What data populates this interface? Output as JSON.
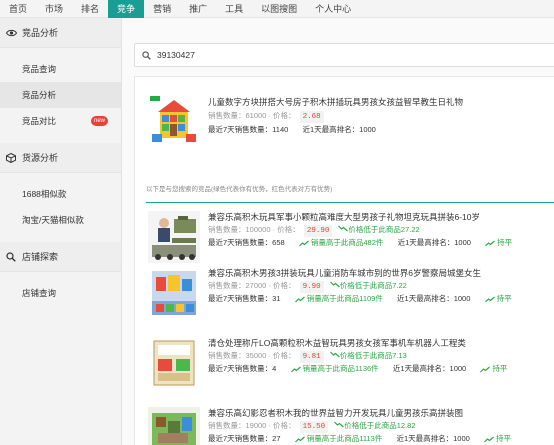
{
  "nav": {
    "items": [
      "首页",
      "市场",
      "排名",
      "竞争",
      "营销",
      "推广",
      "工具",
      "以图搜图",
      "个人中心"
    ],
    "active_index": 3
  },
  "sidebar": {
    "sections": [
      {
        "title": "竞品分析",
        "icon": "eye-icon",
        "links": [
          {
            "label": "竞品查询"
          },
          {
            "label": "竞品分析",
            "active": true
          },
          {
            "label": "竞品对比",
            "badge": "new"
          }
        ]
      },
      {
        "title": "货源分析",
        "icon": "cube-icon",
        "links": [
          {
            "label": "1688相似款"
          },
          {
            "label": "淘宝/天猫相似款"
          }
        ]
      },
      {
        "title": "店铺探索",
        "icon": "search-icon",
        "links": [
          {
            "label": "店铺查询"
          }
        ]
      }
    ]
  },
  "search": {
    "value": "39130427"
  },
  "main_product": {
    "title": "儿童数字方块拼搭大号房子积木拼插玩具男孩女孩益智早教生日礼物",
    "sales_label": "销售数量：61000",
    "price_label": "价格：",
    "price": "2.68",
    "sales7_label": "最近7天销售数量：",
    "sales7": "1140",
    "rank_label": "近1天最高排名：1000"
  },
  "note": "以下是与您搜索的竞品(绿色代表你有优势，红色代表对方有优势)",
  "competitors": [
    {
      "title": "兼容乐高积木玩具军事小颗粒高难度大型男孩子礼物坦克玩具拼装6-10岁",
      "sales_label": "销售数量：100000",
      "price": "29.90",
      "price_compare": "价格低于此商品27.22",
      "sales7": "658",
      "sales_compare": "销量高于此商品482件",
      "rank_label": "近1天最高排名：1000",
      "rank_extra": "持平"
    },
    {
      "title": "兼容乐高积木男孩3拼装玩具儿童消防车城市别的世界6岁警察局城堡女生",
      "sales_label": "销售数量：27000",
      "price": "9.90",
      "price_compare": "价格低于此商品7.22",
      "sales7": "31",
      "sales_compare": "销量高于此商品1109件",
      "rank_label": "近1天最高排名：1000",
      "rank_extra": "持平"
    },
    {
      "title": "清仓处理称斤LO高颗粒积木益智玩具男孩女孩军事机车机器人工程类",
      "sales_label": "销售数量：35000",
      "price": "9.81",
      "price_compare": "价格低于此商品7.13",
      "sales7": "4",
      "sales_compare": "销量高于此商品1136件",
      "rank_label": "近1天最高排名：1000",
      "rank_extra": "持平"
    },
    {
      "title": "兼容乐高幻影忍者积木我的世界益智力开发玩具儿童男孩乐高拼装图",
      "sales_label": "销售数量：19000",
      "price": "15.50",
      "price_compare": "价格低于此商品12.82",
      "sales7": "27",
      "sales_compare": "销量高于此商品1113件",
      "rank_label": "近1天最高排名：1000",
      "rank_extra": "持平"
    }
  ],
  "labels": {
    "price": "价格：",
    "sales7": "最近7天销售数量：",
    "dot": "·"
  },
  "colors": {
    "accent": "#1a9e93",
    "price_red": "#e4433a",
    "green": "#2aa745"
  }
}
